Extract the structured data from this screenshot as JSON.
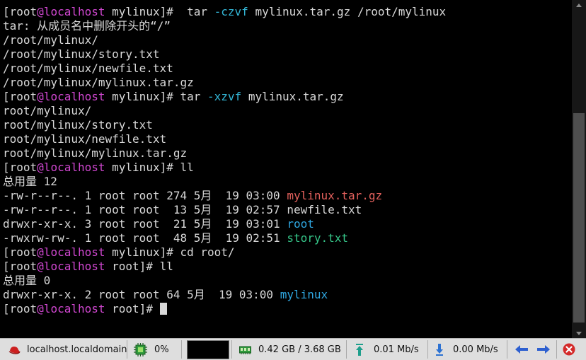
{
  "terminal": {
    "lines": [
      [
        {
          "t": "[root"
        },
        {
          "t": "@",
          "c": "mag"
        },
        {
          "t": "localhost",
          "c": "mag"
        },
        {
          "t": " mylinux]#  tar "
        },
        {
          "t": "-czvf",
          "c": "cyan"
        },
        {
          "t": " mylinux.tar.gz /root/mylinux"
        }
      ],
      [
        {
          "t": "tar: 从成员名中删除开头的“/”"
        }
      ],
      [
        {
          "t": "/root/mylinux/"
        }
      ],
      [
        {
          "t": "/root/mylinux/story.txt"
        }
      ],
      [
        {
          "t": "/root/mylinux/newfile.txt"
        }
      ],
      [
        {
          "t": "/root/mylinux/mylinux.tar.gz"
        }
      ],
      [
        {
          "t": "[root"
        },
        {
          "t": "@",
          "c": "mag"
        },
        {
          "t": "localhost",
          "c": "mag"
        },
        {
          "t": " mylinux]# tar "
        },
        {
          "t": "-xzvf",
          "c": "cyan"
        },
        {
          "t": " mylinux.tar.gz"
        }
      ],
      [
        {
          "t": "root/mylinux/"
        }
      ],
      [
        {
          "t": "root/mylinux/story.txt"
        }
      ],
      [
        {
          "t": "root/mylinux/newfile.txt"
        }
      ],
      [
        {
          "t": "root/mylinux/mylinux.tar.gz"
        }
      ],
      [
        {
          "t": "[root"
        },
        {
          "t": "@",
          "c": "mag"
        },
        {
          "t": "localhost",
          "c": "mag"
        },
        {
          "t": " mylinux]# ll"
        }
      ],
      [
        {
          "t": "总用量 12"
        }
      ],
      [
        {
          "t": "-rw-r--r--. 1 root root 274 5月  19 03:00 "
        },
        {
          "t": "mylinux.tar.gz",
          "c": "red"
        }
      ],
      [
        {
          "t": "-rw-r--r--. 1 root root  13 5月  19 02:57 newfile.txt"
        }
      ],
      [
        {
          "t": "drwxr-xr-x. 3 root root  21 5月  19 03:01 "
        },
        {
          "t": "root",
          "c": "blue"
        }
      ],
      [
        {
          "t": "-rwxrw-rw-. 1 root root  48 5月  19 02:51 "
        },
        {
          "t": "story.txt",
          "c": "green"
        }
      ],
      [
        {
          "t": "[root"
        },
        {
          "t": "@",
          "c": "mag"
        },
        {
          "t": "localhost",
          "c": "mag"
        },
        {
          "t": " mylinux]# cd root/"
        }
      ],
      [
        {
          "t": "[root"
        },
        {
          "t": "@",
          "c": "mag"
        },
        {
          "t": "localhost",
          "c": "mag"
        },
        {
          "t": " root]# ll"
        }
      ],
      [
        {
          "t": "总用量 0"
        }
      ],
      [
        {
          "t": "drwxr-xr-x. 2 root root 64 5月  19 03:00 "
        },
        {
          "t": "mylinux",
          "c": "blue"
        }
      ],
      [
        {
          "t": "[root"
        },
        {
          "t": "@",
          "c": "mag"
        },
        {
          "t": "localhost",
          "c": "mag"
        },
        {
          "t": " root]# "
        },
        {
          "cursor": true
        }
      ]
    ]
  },
  "statusbar": {
    "host": "localhost.localdomain",
    "cpu": "0%",
    "memory": "0.42 GB / 3.68 GB",
    "upload": "0.01 Mb/s",
    "download": "0.00 Mb/s"
  },
  "colors": {
    "mag": "#d147d1",
    "cyan": "#33b6d6",
    "red": "#e2605c",
    "blue": "#2fa6e0",
    "green": "#36c78a"
  }
}
